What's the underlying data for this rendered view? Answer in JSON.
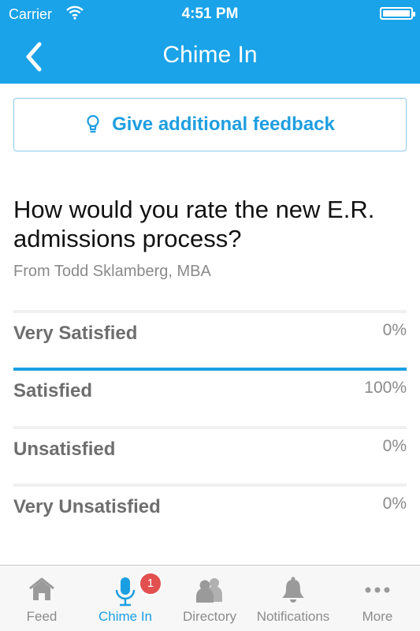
{
  "status_bar": {
    "carrier": "Carrier",
    "time": "4:51 PM"
  },
  "nav": {
    "title": "Chime In",
    "back_icon": "chevron-left-icon"
  },
  "feedback_button": {
    "label": "Give additional feedback",
    "icon": "lightbulb-icon"
  },
  "question": {
    "text": "How would you rate the new E.R. admissions process?",
    "author": "From Todd Sklamberg, MBA"
  },
  "options": [
    {
      "label": "Very Satisfied",
      "percent_text": "0%",
      "percent": 0
    },
    {
      "label": "Satisfied",
      "percent_text": "100%",
      "percent": 100
    },
    {
      "label": "Unsatisfied",
      "percent_text": "0%",
      "percent": 0
    },
    {
      "label": "Very Unsatisfied",
      "percent_text": "0%",
      "percent": 0
    }
  ],
  "tabbar": {
    "tabs": [
      {
        "label": "Feed",
        "icon": "home-icon"
      },
      {
        "label": "Chime In",
        "icon": "microphone-icon",
        "active": true,
        "badge": "1"
      },
      {
        "label": "Directory",
        "icon": "people-icon"
      },
      {
        "label": "Notifications",
        "icon": "bell-icon"
      },
      {
        "label": "More",
        "icon": "more-dots-icon"
      }
    ]
  },
  "colors": {
    "accent": "#1aa3e8",
    "badge": "#e25050",
    "muted": "#8c8c8c"
  }
}
